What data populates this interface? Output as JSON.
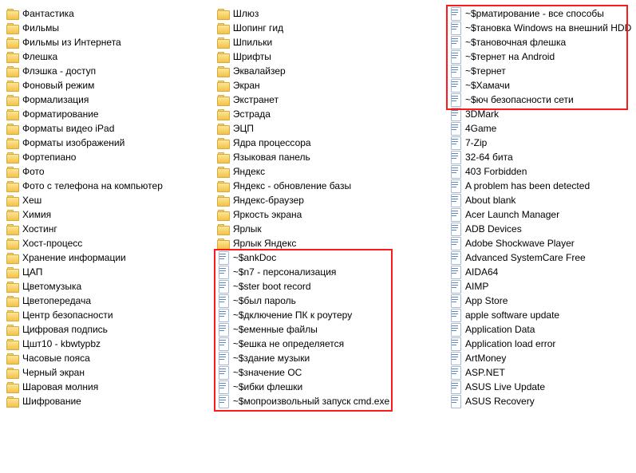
{
  "columns": [
    {
      "items": [
        {
          "type": "folder",
          "label": "Фантастика"
        },
        {
          "type": "folder",
          "label": "Фильмы"
        },
        {
          "type": "folder",
          "label": "Фильмы из Интернета"
        },
        {
          "type": "folder",
          "label": "Флешка"
        },
        {
          "type": "folder",
          "label": "Флэшка - доступ"
        },
        {
          "type": "folder",
          "label": "Фоновый режим"
        },
        {
          "type": "folder",
          "label": "Формализация"
        },
        {
          "type": "folder",
          "label": "Форматирование"
        },
        {
          "type": "folder",
          "label": "Форматы видео iPad"
        },
        {
          "type": "folder",
          "label": "Форматы изображений"
        },
        {
          "type": "folder",
          "label": "Фортепиано"
        },
        {
          "type": "folder",
          "label": "Фото"
        },
        {
          "type": "folder",
          "label": "Фото с телефона на компьютер"
        },
        {
          "type": "folder",
          "label": "Хеш"
        },
        {
          "type": "folder",
          "label": "Химия"
        },
        {
          "type": "folder",
          "label": "Хостинг"
        },
        {
          "type": "folder",
          "label": "Хост-процесс"
        },
        {
          "type": "folder",
          "label": "Хранение информации"
        },
        {
          "type": "folder",
          "label": "ЦАП"
        },
        {
          "type": "folder",
          "label": "Цветомузыка"
        },
        {
          "type": "folder",
          "label": "Цветопередача"
        },
        {
          "type": "folder",
          "label": "Центр безопасности"
        },
        {
          "type": "folder",
          "label": "Цифровая подпись"
        },
        {
          "type": "folder",
          "label": "Цшт10 - kbwtypbz"
        },
        {
          "type": "folder",
          "label": "Часовые пояса"
        },
        {
          "type": "folder",
          "label": "Черный экран"
        },
        {
          "type": "folder",
          "label": "Шаровая молния"
        },
        {
          "type": "folder",
          "label": "Шифрование"
        }
      ]
    },
    {
      "items": [
        {
          "type": "folder",
          "label": "Шлюз"
        },
        {
          "type": "folder",
          "label": "Шопинг гид"
        },
        {
          "type": "folder",
          "label": "Шпильки"
        },
        {
          "type": "folder",
          "label": "Шрифты"
        },
        {
          "type": "folder",
          "label": "Эквалайзер"
        },
        {
          "type": "folder",
          "label": "Экран"
        },
        {
          "type": "folder",
          "label": "Экстранет"
        },
        {
          "type": "folder",
          "label": "Эстрада"
        },
        {
          "type": "folder",
          "label": "ЭЦП"
        },
        {
          "type": "folder",
          "label": "Ядра процессора"
        },
        {
          "type": "folder",
          "label": "Языковая панель"
        },
        {
          "type": "folder",
          "label": "Яндекс"
        },
        {
          "type": "folder",
          "label": "Яндекс - обновление базы"
        },
        {
          "type": "folder",
          "label": "Яндекс-браузер"
        },
        {
          "type": "folder",
          "label": "Яркость экрана"
        },
        {
          "type": "folder",
          "label": "Ярлык"
        },
        {
          "type": "folder",
          "label": "Ярлык Яндекс"
        },
        {
          "type": "doc",
          "label": "~$ankDoc"
        },
        {
          "type": "doc",
          "label": "~$n7 - персонализация"
        },
        {
          "type": "doc",
          "label": "~$ster boot record"
        },
        {
          "type": "doc",
          "label": "~$был пароль"
        },
        {
          "type": "doc",
          "label": "~$дключение ПК к роутеру"
        },
        {
          "type": "doc",
          "label": "~$еменные файлы"
        },
        {
          "type": "doc",
          "label": "~$ешка не определяется"
        },
        {
          "type": "doc",
          "label": "~$здание музыки"
        },
        {
          "type": "doc",
          "label": "~$значение ОС"
        },
        {
          "type": "doc",
          "label": "~$ибки флешки"
        },
        {
          "type": "doc",
          "label": "~$мопроизвольный запуск cmd.exe"
        }
      ],
      "highlight": {
        "from": 17,
        "to": 27
      }
    },
    {
      "items": [
        {
          "type": "doc",
          "label": "~$рматирование - все способы"
        },
        {
          "type": "doc",
          "label": "~$тановка Windows на внешний HDD"
        },
        {
          "type": "doc",
          "label": "~$тановочная флешка"
        },
        {
          "type": "doc",
          "label": "~$тернет на Android"
        },
        {
          "type": "doc",
          "label": "~$тернет"
        },
        {
          "type": "doc",
          "label": "~$Хамачи"
        },
        {
          "type": "doc",
          "label": "~$юч безопасности сети"
        },
        {
          "type": "doc",
          "label": "3DMark"
        },
        {
          "type": "doc",
          "label": "4Game"
        },
        {
          "type": "doc",
          "label": "7-Zip"
        },
        {
          "type": "doc",
          "label": "32-64 бита"
        },
        {
          "type": "doc",
          "label": "403 Forbidden"
        },
        {
          "type": "doc",
          "label": "A problem has been detected"
        },
        {
          "type": "doc",
          "label": "About blank"
        },
        {
          "type": "doc",
          "label": "Acer Launch Manager"
        },
        {
          "type": "doc",
          "label": "ADB Devices"
        },
        {
          "type": "doc",
          "label": "Adobe Shockwave Player"
        },
        {
          "type": "doc",
          "label": "Advanced SystemCare Free"
        },
        {
          "type": "doc",
          "label": "AIDA64"
        },
        {
          "type": "doc",
          "label": "AIMP"
        },
        {
          "type": "doc",
          "label": "App Store"
        },
        {
          "type": "doc",
          "label": "apple software update"
        },
        {
          "type": "doc",
          "label": "Application Data"
        },
        {
          "type": "doc",
          "label": "Application load error"
        },
        {
          "type": "doc",
          "label": "ArtMoney"
        },
        {
          "type": "doc",
          "label": "ASP.NET"
        },
        {
          "type": "doc",
          "label": "ASUS Live Update"
        },
        {
          "type": "doc",
          "label": "ASUS Recovery"
        }
      ],
      "highlight": {
        "from": 0,
        "to": 6
      }
    }
  ]
}
